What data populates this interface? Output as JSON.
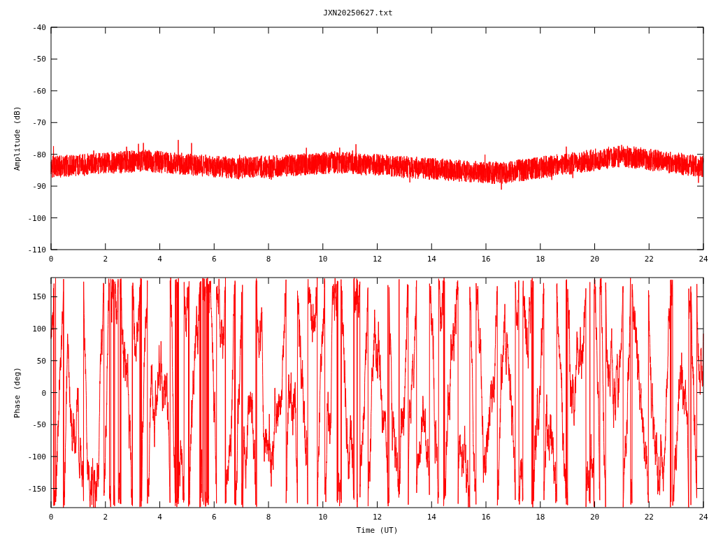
{
  "title": "JXN20250627.txt",
  "panels": [
    {
      "kind": "amplitude",
      "ylabel": "Amplitude (dB)",
      "yticks": [
        "-40",
        "-50",
        "-60",
        "-70",
        "-80",
        "-90",
        "-100",
        "-110"
      ],
      "xticks": [
        "0",
        "2",
        "4",
        "6",
        "8",
        "10",
        "12",
        "14",
        "16",
        "18",
        "20",
        "22",
        "24"
      ]
    },
    {
      "kind": "phase",
      "ylabel": "Phase (deg)",
      "yticks": [
        "150",
        "100",
        "50",
        "0",
        "-50",
        "-100",
        "-150"
      ],
      "xticks": [
        "0",
        "2",
        "4",
        "6",
        "8",
        "10",
        "12",
        "14",
        "16",
        "18",
        "20",
        "22",
        "24"
      ],
      "xlabel": "Time (UT)"
    }
  ]
}
